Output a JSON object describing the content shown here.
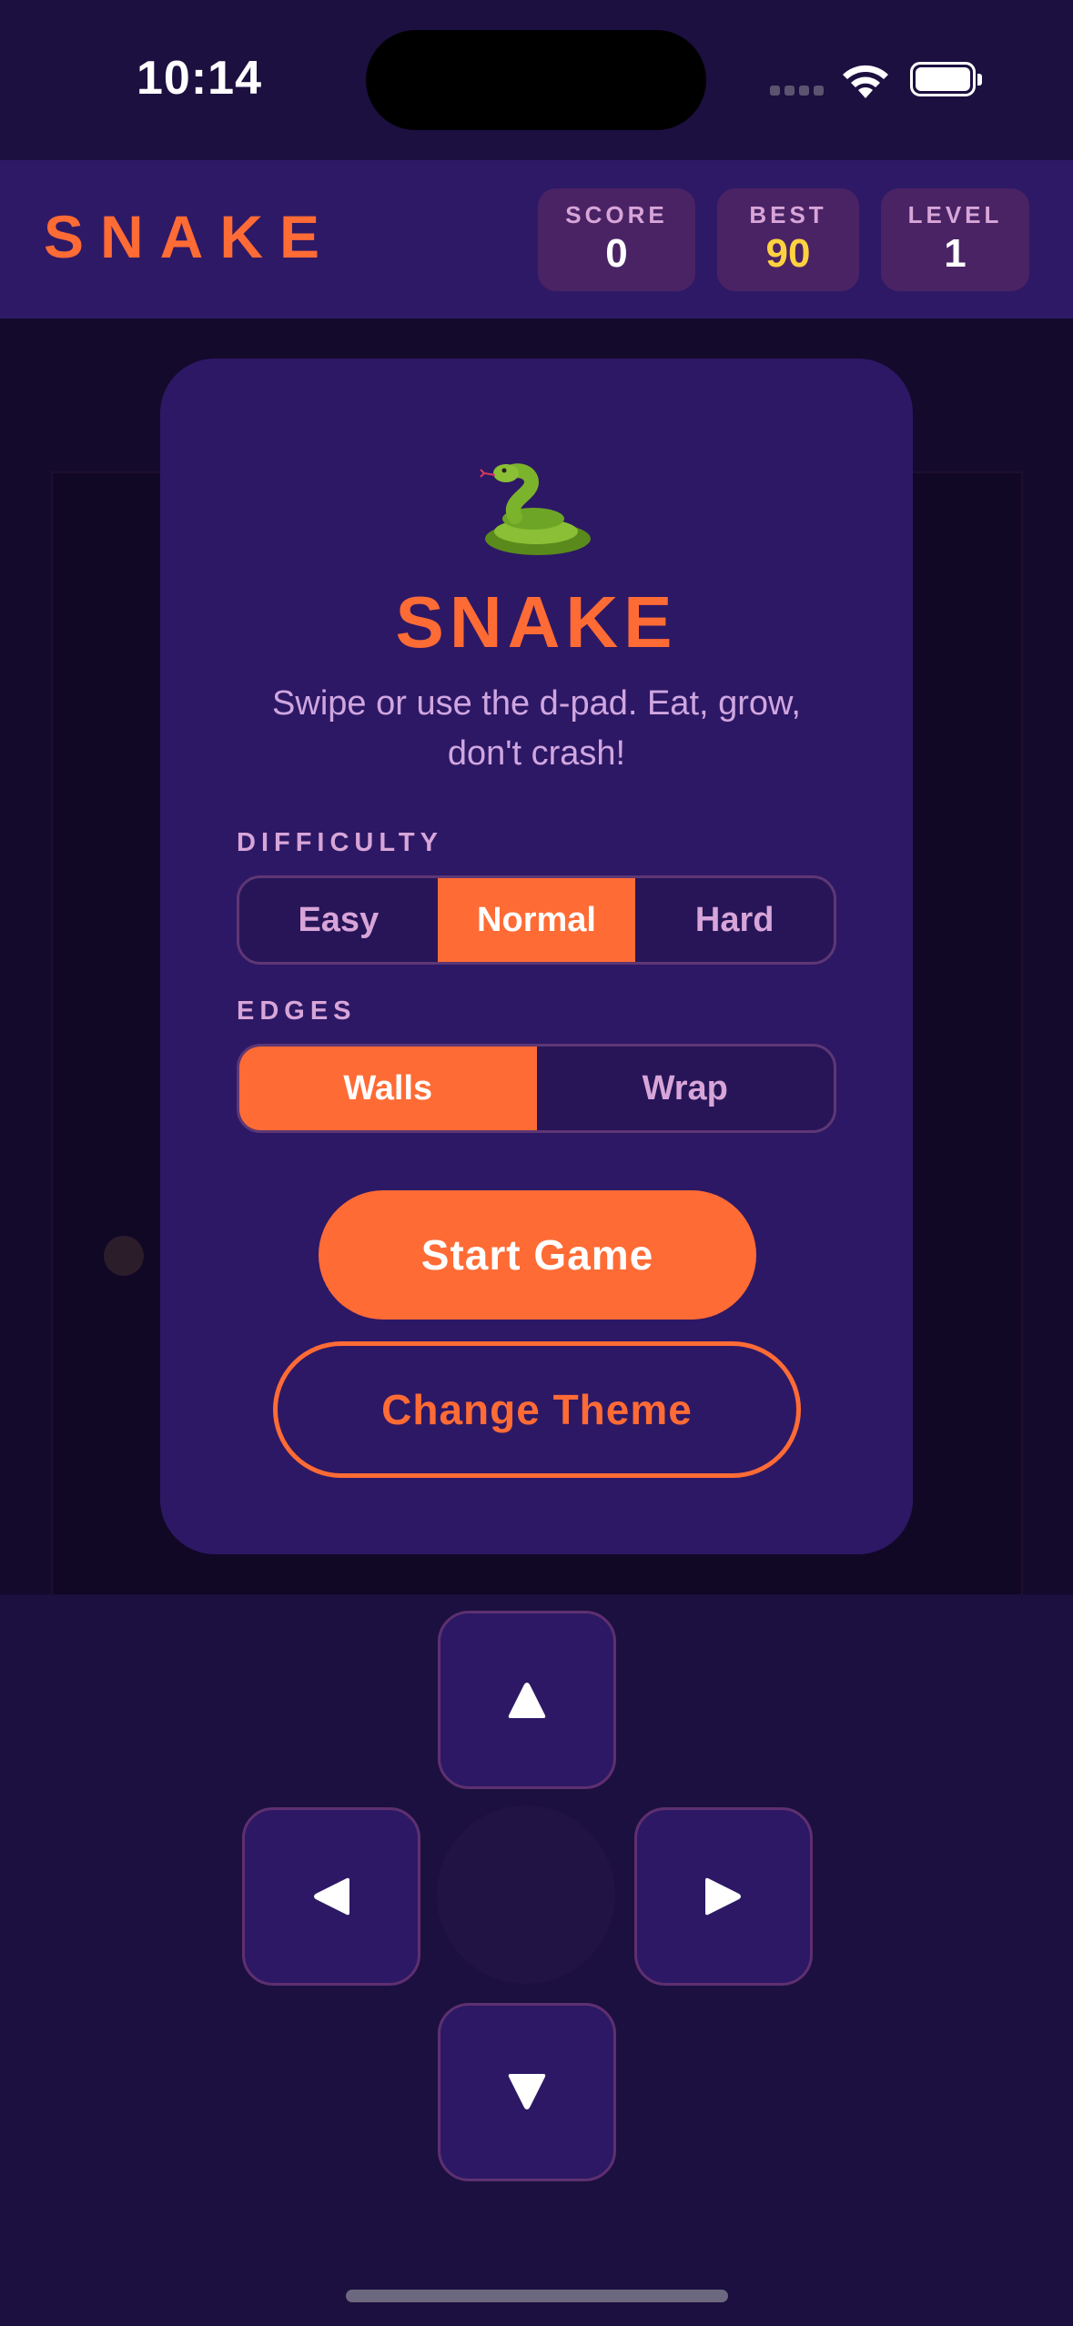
{
  "status_bar": {
    "time": "10:14"
  },
  "header": {
    "brand": "SNAKE",
    "stats": [
      {
        "label": "SCORE",
        "value": "0"
      },
      {
        "label": "BEST",
        "value": "90"
      },
      {
        "label": "LEVEL",
        "value": "1"
      }
    ]
  },
  "modal": {
    "emoji": "snake-emoji",
    "title": "SNAKE",
    "subtitle": "Swipe or use the d-pad. Eat, grow, don't crash!",
    "difficulty": {
      "label": "DIFFICULTY",
      "options": [
        "Easy",
        "Normal",
        "Hard"
      ],
      "selected": "Normal"
    },
    "edges": {
      "label": "EDGES",
      "options": [
        "Walls",
        "Wrap"
      ],
      "selected": "Walls"
    },
    "start_button": "Start Game",
    "theme_button": "Change Theme"
  },
  "dpad": {
    "up_icon": "triangle-up-icon",
    "left_icon": "triangle-left-icon",
    "right_icon": "triangle-right-icon",
    "down_icon": "triangle-down-icon"
  },
  "colors": {
    "accent": "#ff6b35",
    "best": "#ffd23f",
    "background": "#1c1040",
    "panel": "#2d1865"
  }
}
